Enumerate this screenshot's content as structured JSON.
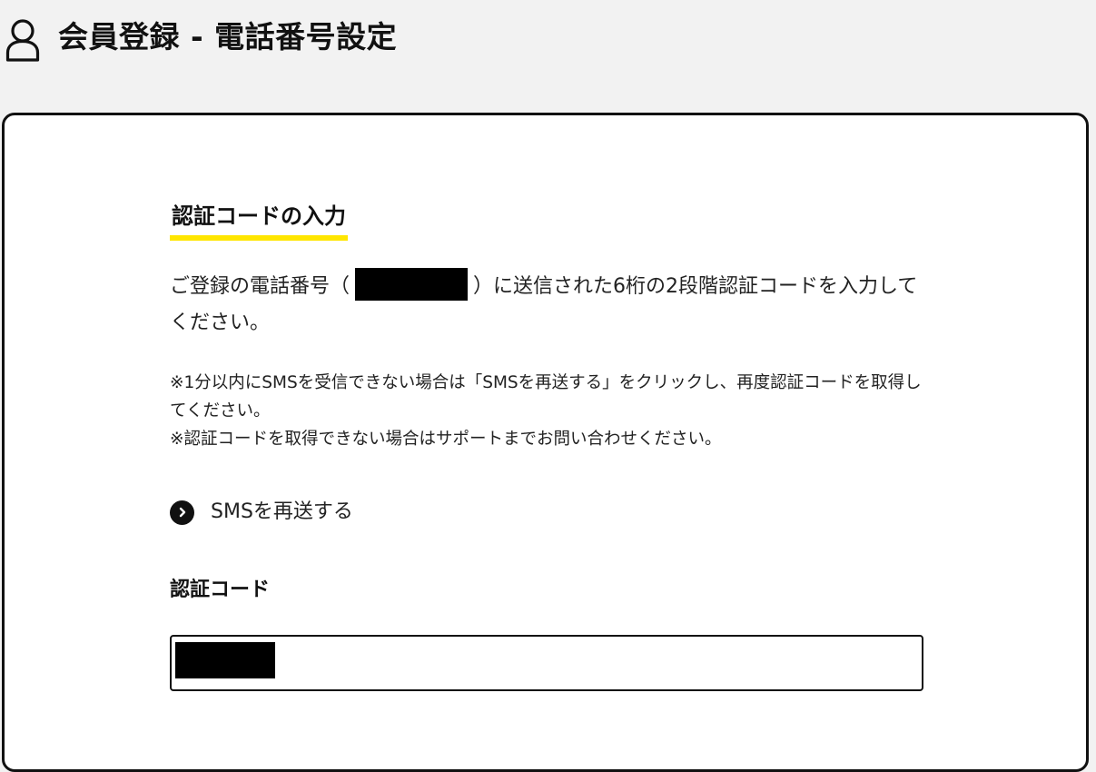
{
  "header": {
    "title": "会員登録 - 電話番号設定",
    "icon": "user-icon"
  },
  "form": {
    "section_title": "認証コードの入力",
    "instruction_prefix": "ご登録の電話番号（",
    "instruction_suffix": "）に送信された6桁の2段階認証コードを入力してください。",
    "notes": [
      "※1分以内にSMSを受信できない場合は「SMSを再送する」をクリックし、再度認証コードを取得してください。",
      "※認証コードを取得できない場合はサポートまでお問い合わせください。"
    ],
    "resend_label": "SMSを再送する",
    "resend_icon": "chevron-right-circle-icon",
    "code_label": "認証コード",
    "code_value": ""
  },
  "colors": {
    "background": "#f2f2f2",
    "card": "#ffffff",
    "accent_underline": "#ffe600",
    "text": "#111111"
  }
}
